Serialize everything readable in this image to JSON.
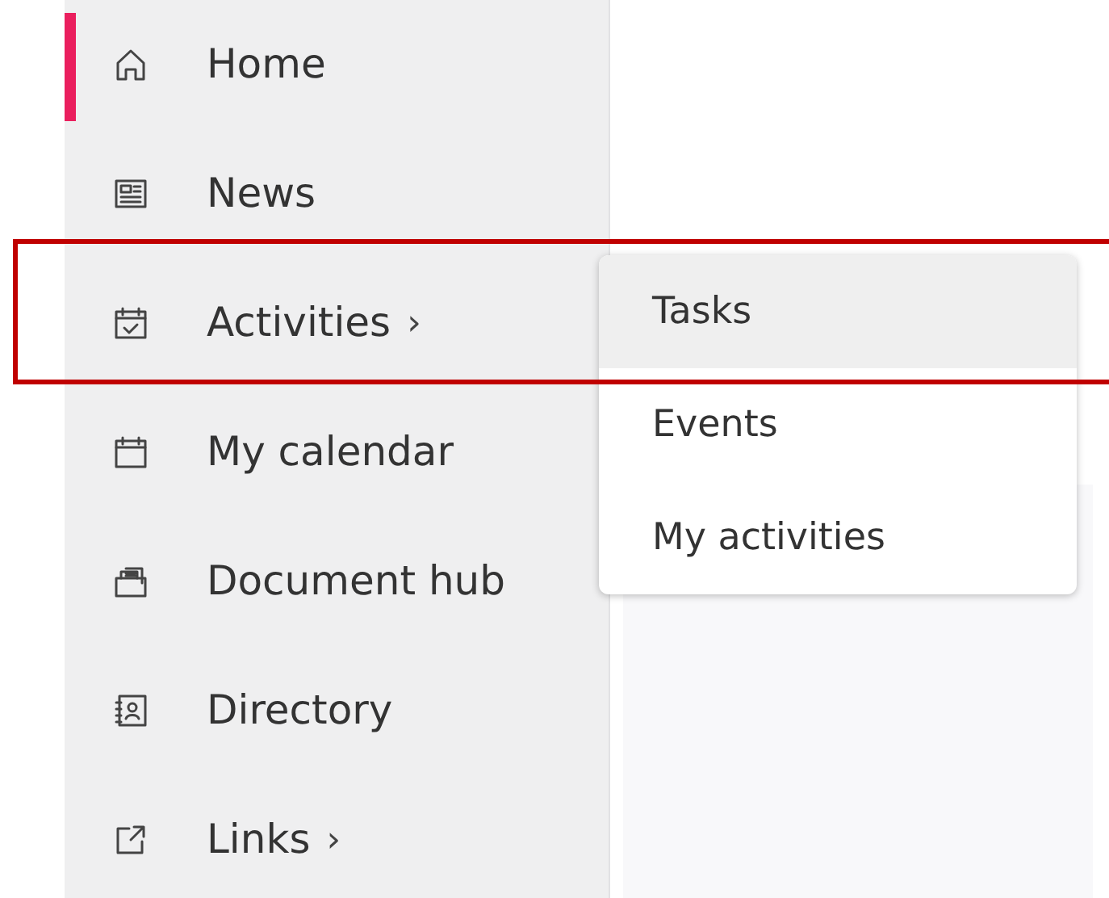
{
  "nav": [
    {
      "label": "Home",
      "selected": true,
      "has_submenu": false,
      "highlighted": false
    },
    {
      "label": "News",
      "selected": false,
      "has_submenu": false,
      "highlighted": false
    },
    {
      "label": "Activities",
      "selected": false,
      "has_submenu": true,
      "highlighted": true
    },
    {
      "label": "My calendar",
      "selected": false,
      "has_submenu": false,
      "highlighted": false
    },
    {
      "label": "Document hub",
      "selected": false,
      "has_submenu": false,
      "highlighted": false
    },
    {
      "label": "Directory",
      "selected": false,
      "has_submenu": false,
      "highlighted": false
    },
    {
      "label": "Links",
      "selected": false,
      "has_submenu": true,
      "highlighted": false
    }
  ],
  "chevron": "›",
  "submenu": [
    {
      "label": "Tasks",
      "selected": true
    },
    {
      "label": "Events",
      "selected": false
    },
    {
      "label": "My activities",
      "selected": false
    }
  ]
}
